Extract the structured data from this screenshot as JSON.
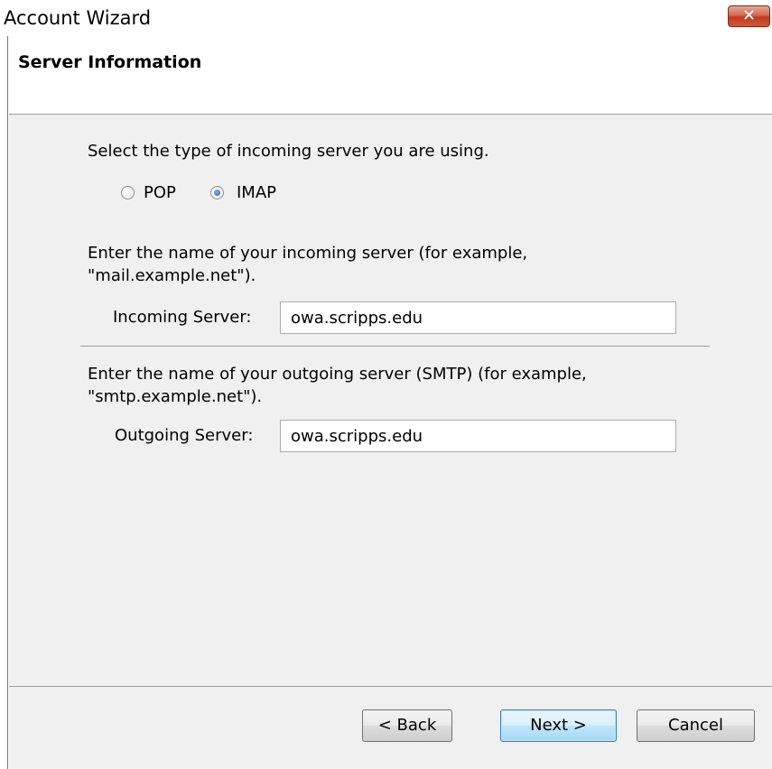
{
  "window": {
    "title": "Account Wizard",
    "close_glyph": "✕"
  },
  "header": {
    "title": "Server Information"
  },
  "incoming_type": {
    "prompt": "Select the type of incoming server you are using.",
    "options": [
      {
        "label": "POP",
        "selected": false
      },
      {
        "label": "IMAP",
        "selected": true
      }
    ]
  },
  "incoming": {
    "hint_line1": "Enter the name of your incoming server (for example,",
    "hint_line2": "\"mail.example.net\").",
    "label": "Incoming Server:",
    "value": "owa.scripps.edu"
  },
  "outgoing": {
    "hint_line1": "Enter the name of your outgoing server (SMTP) (for example,",
    "hint_line2": "\"smtp.example.net\").",
    "label": "Outgoing Server:",
    "value": "owa.scripps.edu"
  },
  "buttons": {
    "back": "< Back",
    "next": "Next >",
    "cancel": "Cancel"
  },
  "colors": {
    "content_bg": "#f0f0f0",
    "close_button": "#c1391c",
    "default_button_border": "#3c7fb1"
  }
}
